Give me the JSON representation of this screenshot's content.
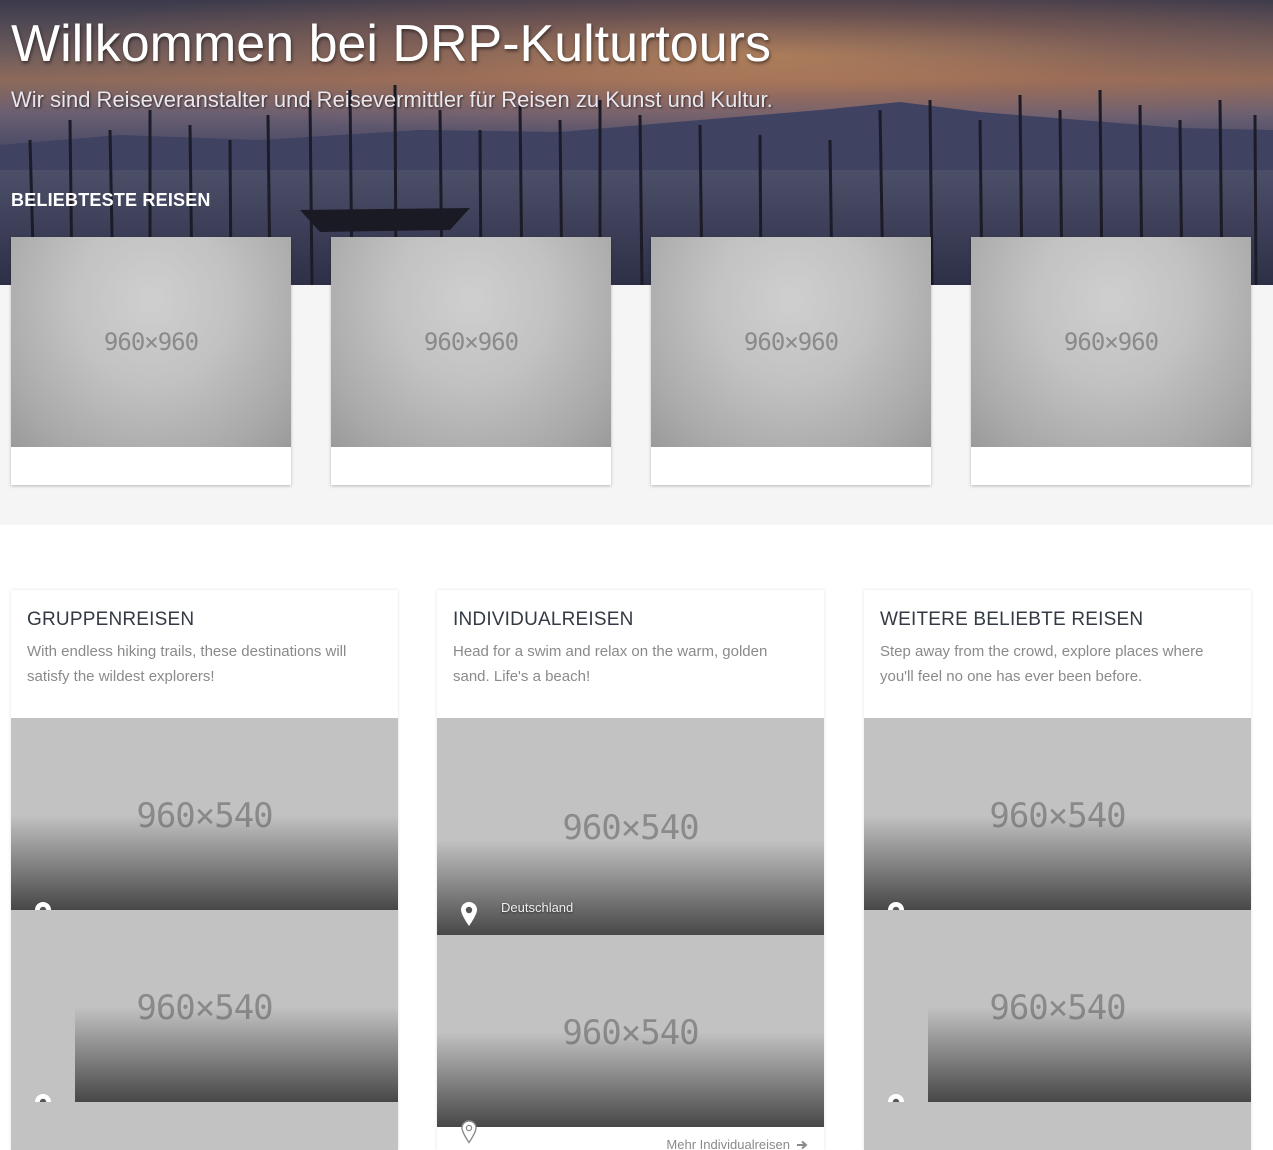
{
  "hero": {
    "title": "Willkommen bei DRP-Kulturtours",
    "subtitle": "Wir sind Reiseveranstalter und Reisevermittler für Reisen zu Kunst und Kultur.",
    "section_heading": "BELIEBTESTE REISEN"
  },
  "top_cards": [
    {
      "placeholder": "960×960"
    },
    {
      "placeholder": "960×960"
    },
    {
      "placeholder": "960×960"
    },
    {
      "placeholder": "960×960"
    }
  ],
  "columns": [
    {
      "title": "GRUPPENREISEN",
      "description": "With endless hiking trails, these destinations will satisfy the wildest explorers!",
      "tiles": [
        {
          "placeholder": "960×540",
          "location": ""
        },
        {
          "placeholder": "960×540",
          "location": ""
        }
      ]
    },
    {
      "title": "INDIVIDUALREISEN",
      "description": "Head for a swim and relax on the warm, golden sand. Life's a beach!",
      "tiles": [
        {
          "placeholder": "960×540",
          "location": "Deutschland"
        },
        {
          "placeholder": "960×540",
          "location": ""
        }
      ],
      "more_link": "Mehr Individualreisen"
    },
    {
      "title": "WEITERE BELIEBTE REISEN",
      "description": "Step away from the crowd, explore places where you'll feel no one has ever been before.",
      "tiles": [
        {
          "placeholder": "960×540",
          "location": ""
        },
        {
          "placeholder": "960×540",
          "location": ""
        }
      ]
    }
  ],
  "icons": {
    "pin": "map-pin-icon",
    "arrow": "arrow-right-icon"
  }
}
